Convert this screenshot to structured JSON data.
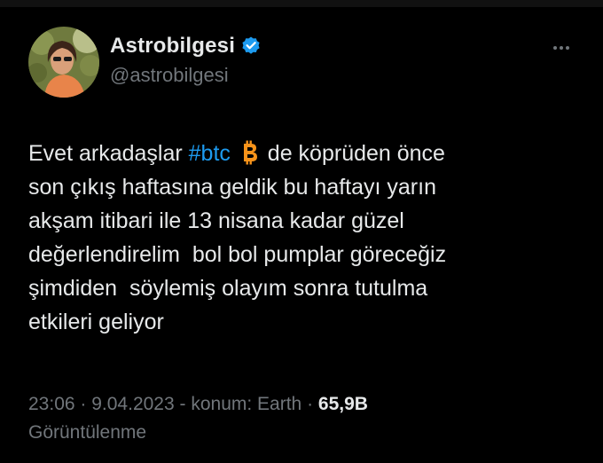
{
  "user": {
    "display_name": "Astrobilgesi",
    "handle": "@astrobilgesi"
  },
  "tweet": {
    "line1_before": "Evet arkadaşlar ",
    "hashtag": "#btc",
    "line1_after": " de köprüden önce",
    "line2": "son çıkış haftasına geldik bu haftayı yarın",
    "line3": "akşam itibari ile 13 nisana kadar güzel",
    "line4": "değerlendirelim  bol bol pumplar göreceğiz",
    "line5": "şimdiden  söylemiş olayım sonra tutulma",
    "line6": "etkileri geliyor"
  },
  "meta": {
    "time": "23:06",
    "sep1": " · ",
    "date": "9.04.2023",
    "location": " - konum: Earth",
    "sep2": " · ",
    "views_count": "65,9B",
    "views_label": "Görüntülenme"
  },
  "colors": {
    "background": "#000000",
    "text": "#e7e9ea",
    "secondary": "#71767b",
    "accent": "#1d9bf0",
    "bitcoin": "#f7931a"
  },
  "icons": {
    "verified": "verified-badge-icon",
    "more": "more-icon",
    "btc": "bitcoin-emoji-icon"
  }
}
